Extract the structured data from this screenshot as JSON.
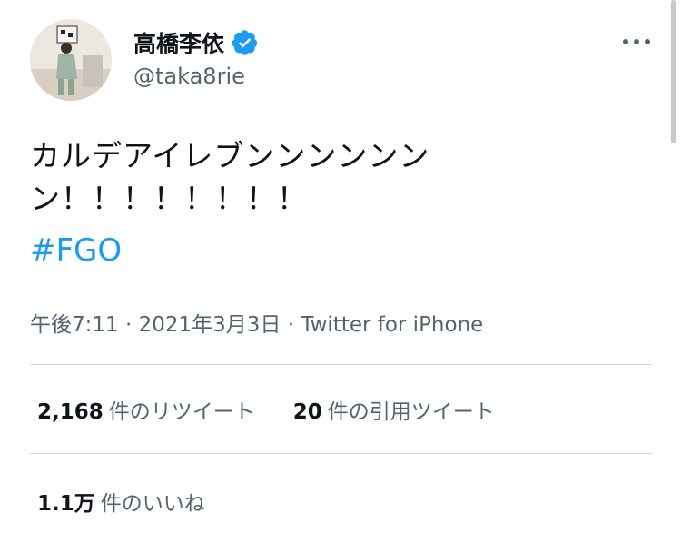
{
  "author": {
    "display_name": "高橋李依",
    "handle": "@taka8rie",
    "verified_icon": "verified-badge-icon",
    "avatar_icon": "profile-photo"
  },
  "more_icon": "more-options-icon",
  "tweet": {
    "text_line1": "カルデアイレブンンンンンン",
    "text_line2": "ン！！！！！！！！",
    "hashtag": "#FGO"
  },
  "meta": {
    "time": "午後7:11",
    "sep1": "·",
    "date": "2021年3月3日",
    "sep2": "·",
    "source": "Twitter for iPhone"
  },
  "stats": {
    "retweets_count": "2,168",
    "retweets_label": "件のリツイート",
    "quotes_count": "20",
    "quotes_label": "件の引用ツイート",
    "likes_count": "1.1万",
    "likes_label": "件のいいね"
  },
  "colors": {
    "accent": "#1d9bf0",
    "text": "#0f1419",
    "secondary": "#536471",
    "divider": "#cfd9de"
  }
}
